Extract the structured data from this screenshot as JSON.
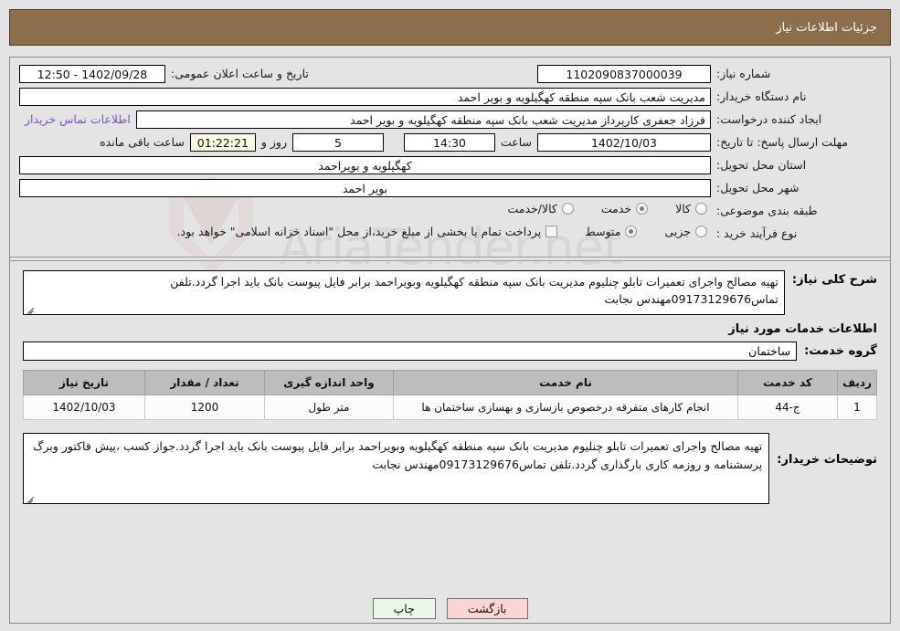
{
  "header": {
    "title": "جزئیات اطلاعات نیاز"
  },
  "watermark": {
    "text": "AriaTender.net"
  },
  "form": {
    "need_number": {
      "label": "شماره نیاز:",
      "value": "1102090837000039"
    },
    "announce_datetime": {
      "label": "تاریخ و ساعت اعلان عمومی:",
      "value": "1402/09/28 - 12:50"
    },
    "buyer_org": {
      "label": "نام دستگاه خریدار:",
      "value": "مدیریت شعب بانک سپه منطقه کهگیلویه و بویر احمد"
    },
    "requester": {
      "label": "ایجاد کننده درخواست:",
      "value": "فرزاد جعفری کارپرداز مدیریت شعب بانک سپه منطقه کهگیلویه و بویر احمد"
    },
    "contact_link": "اطلاعات تماس خریدار",
    "deadline": {
      "label": "مهلت ارسال پاسخ: تا تاریخ:",
      "date": "1402/10/03",
      "time_label": "ساعت",
      "time": "14:30",
      "days": "5",
      "days_label": "روز و",
      "countdown": "01:22:21",
      "remaining_label": "ساعت باقی مانده"
    },
    "province": {
      "label": "استان محل تحویل:",
      "value": "کهگیلویه و بویراحمد"
    },
    "city": {
      "label": "شهر محل تحویل:",
      "value": "بویر احمد"
    },
    "category": {
      "label": "طبقه بندی موضوعی:",
      "options": [
        "کالا",
        "خدمت",
        "کالا/خدمت"
      ],
      "selected": "خدمت"
    },
    "purchase_type": {
      "label": "نوع فرآیند خرید :",
      "options": [
        "جزیی",
        "متوسط"
      ],
      "selected": "متوسط"
    },
    "treasury_note": {
      "checked": false,
      "text": "پرداخت تمام یا بخشی از مبلغ خرید،از محل \"اسناد خزانه اسلامی\" خواهد بود."
    }
  },
  "description": {
    "label": "شرح کلی نیاز:",
    "value": "تهیه مصالح واجرای تعمیرات تابلو چنلیوم مدیریت بانک سپه منطقه کهگیلویه وبویراحمد برابر فایل پیوست بانک باید اجرا گردد.تلفن تماس09173129676مهندس نجابت"
  },
  "services_section": {
    "heading": "اطلاعات خدمات مورد نیاز",
    "group_label": "گروه خدمت:",
    "group_value": "ساختمان"
  },
  "table": {
    "headers": [
      "ردیف",
      "کد خدمت",
      "نام خدمت",
      "واحد اندازه گیری",
      "تعداد / مقدار",
      "تاریخ نیاز"
    ],
    "rows": [
      {
        "row_no": "1",
        "service_code": "ج-44",
        "service_name": "انجام کارهای متفرقه درخصوص بازسازی و بهسازی ساختمان ها",
        "unit": "متر طول",
        "quantity": "1200",
        "need_date": "1402/10/03"
      }
    ]
  },
  "buyer_notes": {
    "label": "توضیحات خریدار:",
    "value": "تهیه مصالح واجرای تعمیرات تابلو چنلیوم مدیریت بانک سپه منطقه کهگیلویه وبویراحمد برابر فایل پیوست بانک باید اجرا گردد.جواز کسب ،پیش فاکتور وبرگ پرسشنامه و روزمه کاری بارگذاری گردد.تلفن تماس09173129676مهندس نجابت"
  },
  "footer": {
    "print_label": "چاپ",
    "back_label": "بازگشت"
  },
  "colors": {
    "header_bg": "#8d6e4b",
    "link": "#7b52c7",
    "countdown_bg": "#fbfbe4",
    "print_bg": "#eaf7e9",
    "back_bg": "#fbd4d4",
    "table_header_bg": "#bdbdbd"
  }
}
